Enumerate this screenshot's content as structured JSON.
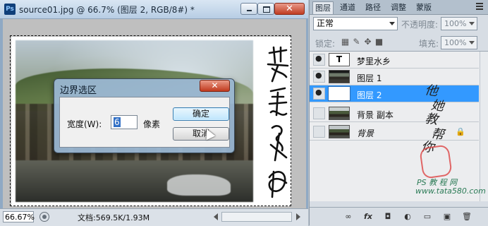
{
  "document": {
    "title": "source01.jpg @ 66.7% (图层 2, RGB/8#) *",
    "app_icon": "Ps",
    "close_glyph": "✕",
    "zoom": "66.67%",
    "doc_info": "文档:569.5K/1.93M"
  },
  "dialog": {
    "title": "边界选区",
    "width_label": "宽度(W):",
    "width_value": "6",
    "unit": "像素",
    "ok_label": "确定",
    "cancel_label": "取消",
    "close_glyph": "✕"
  },
  "panel": {
    "tabs": [
      "图层",
      "通道",
      "路径",
      "调整",
      "蒙版"
    ],
    "blend_mode": "正常",
    "opacity_label": "不透明度:",
    "opacity_value": "100%",
    "lock_label": "锁定:",
    "fill_label": "填充:",
    "fill_value": "100%",
    "layers": [
      {
        "name": "梦里水乡",
        "visible": true,
        "thumb": "T",
        "type": "text"
      },
      {
        "name": "图层 1",
        "visible": true,
        "type": "image"
      },
      {
        "name": "图层 2",
        "visible": true,
        "type": "blank",
        "selected": true
      },
      {
        "name": "背景 副本",
        "visible": false,
        "type": "image"
      },
      {
        "name": "背景",
        "visible": false,
        "type": "image",
        "locked": true
      }
    ],
    "watermark": {
      "brush_text": "他\n  她\n 教\n   帮\n 你",
      "site_line1": "PS 教 程 网",
      "site_line2": "www.tata580.com"
    },
    "bottom_icons": [
      "link-icon",
      "fx-icon",
      "mask-icon",
      "adjustment-icon",
      "group-icon",
      "new-layer-icon",
      "trash-icon"
    ],
    "bottom_glyphs": [
      "∞",
      "fx",
      "◘",
      "◐",
      "▭",
      "▣",
      "🗑"
    ]
  },
  "colors": {
    "selection": "#3399ff",
    "window_close": "#c03d23"
  }
}
